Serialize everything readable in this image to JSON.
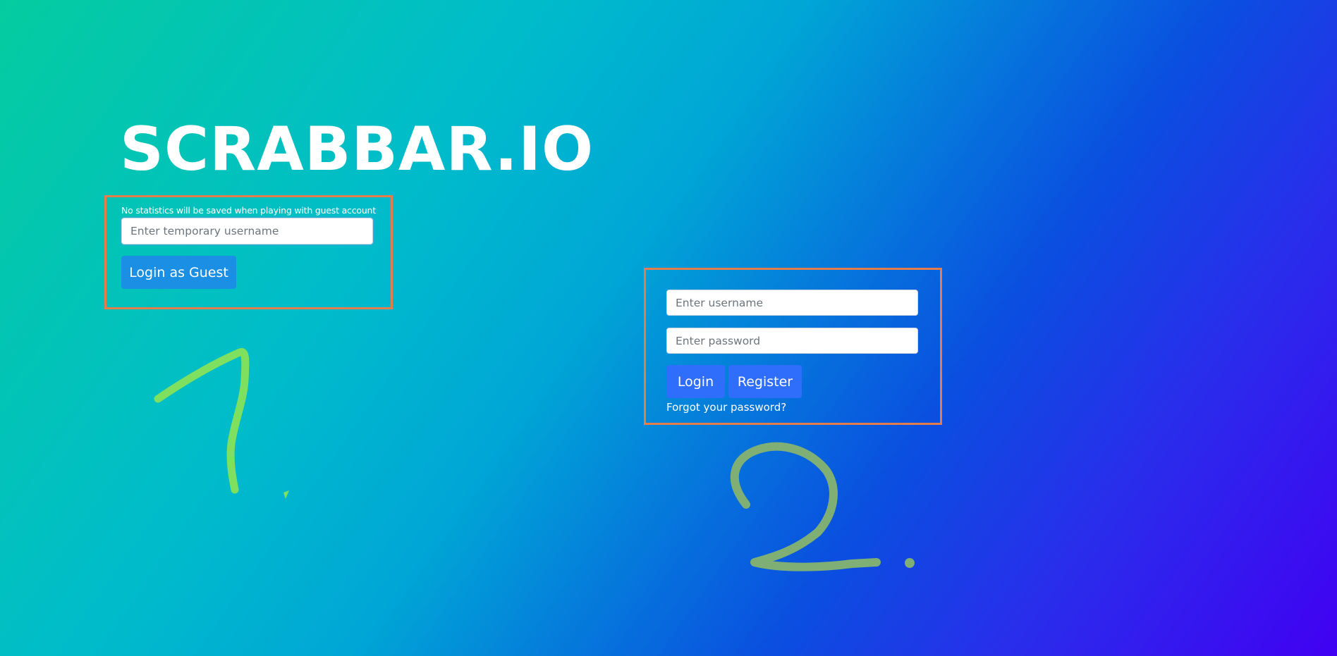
{
  "app": {
    "title": "SCRABBAR.IO"
  },
  "guest": {
    "note": "No statistics will be saved when playing with guest account",
    "username_placeholder": "Enter temporary username",
    "username_value": "",
    "login_button_label": "Login as Guest"
  },
  "account": {
    "username_placeholder": "Enter username",
    "username_value": "",
    "password_placeholder": "Enter password",
    "password_value": "",
    "login_button_label": "Login",
    "register_button_label": "Register",
    "forgot_password_label": "Forgot your password?"
  },
  "annotations": {
    "box_color": "#e37e4c",
    "mark_1_color": "#7ee05e",
    "mark_2_color": "#7faf74"
  },
  "colors": {
    "guest_button": "#1a8fe3",
    "account_buttons": "#2f6dfb"
  }
}
